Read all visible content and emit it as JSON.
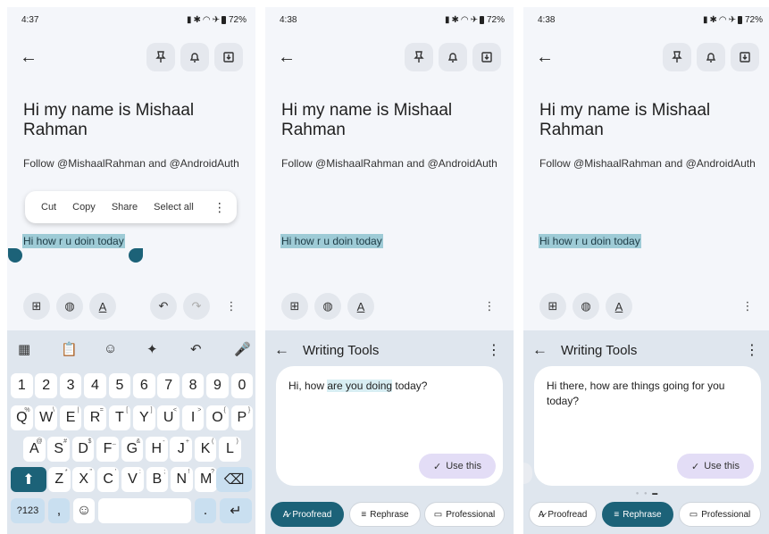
{
  "colors": {
    "accent": "#1c6278",
    "selection": "#9ecbd6",
    "use_button": "#e3ddf6"
  },
  "panels": [
    {
      "status": {
        "time": "4:37",
        "battery": "72%"
      },
      "note": {
        "title": "Hi my name is Mishaal Rahman",
        "body": "Follow @MishaalRahman and @AndroidAuth",
        "selected": "Hi how r u doin today"
      },
      "context_menu": [
        "Cut",
        "Copy",
        "Share",
        "Select all"
      ],
      "keyboard": {
        "numbers": [
          "1",
          "2",
          "3",
          "4",
          "5",
          "6",
          "7",
          "8",
          "9",
          "0"
        ],
        "row1": [
          "Q",
          "W",
          "E",
          "R",
          "T",
          "Y",
          "U",
          "I",
          "O",
          "P"
        ],
        "row1_alt": [
          "%",
          "\\",
          "|",
          "=",
          "[",
          "]",
          "<",
          ">",
          "{",
          "}"
        ],
        "row2": [
          "A",
          "S",
          "D",
          "F",
          "G",
          "H",
          "J",
          "K",
          "L"
        ],
        "row2_alt": [
          "@",
          "#",
          "$",
          "_",
          "&",
          "-",
          "+",
          "(",
          ")"
        ],
        "row3": [
          "Z",
          "X",
          "C",
          "V",
          "B",
          "N",
          "M"
        ],
        "row3_alt": [
          "*",
          "\"",
          "'",
          ":",
          ";",
          "!",
          "?"
        ],
        "sym_label": "?123",
        "comma": ",",
        "period": "."
      }
    },
    {
      "status": {
        "time": "4:38",
        "battery": "72%"
      },
      "note": {
        "title": "Hi my name is Mishaal Rahman",
        "body": "Follow @MishaalRahman and @AndroidAuth",
        "selected": "Hi how r u doin today"
      },
      "writing_tools": {
        "title": "Writing Tools",
        "result_parts": [
          "Hi, how ",
          "are you doing",
          " today?"
        ],
        "use_label": "Use this",
        "chips": [
          "Proofread",
          "Rephrase",
          "Professional"
        ],
        "active_chip": "Proofread"
      }
    },
    {
      "status": {
        "time": "4:38",
        "battery": "72%"
      },
      "note": {
        "title": "Hi my name is Mishaal Rahman",
        "body": "Follow @MishaalRahman and @AndroidAuth",
        "selected": "Hi how r u doin today"
      },
      "writing_tools": {
        "title": "Writing Tools",
        "result": "Hi there, how are things going for you today?",
        "use_label": "Use this",
        "chips": [
          "Proofread",
          "Rephrase",
          "Professional"
        ],
        "active_chip": "Rephrase"
      }
    }
  ]
}
